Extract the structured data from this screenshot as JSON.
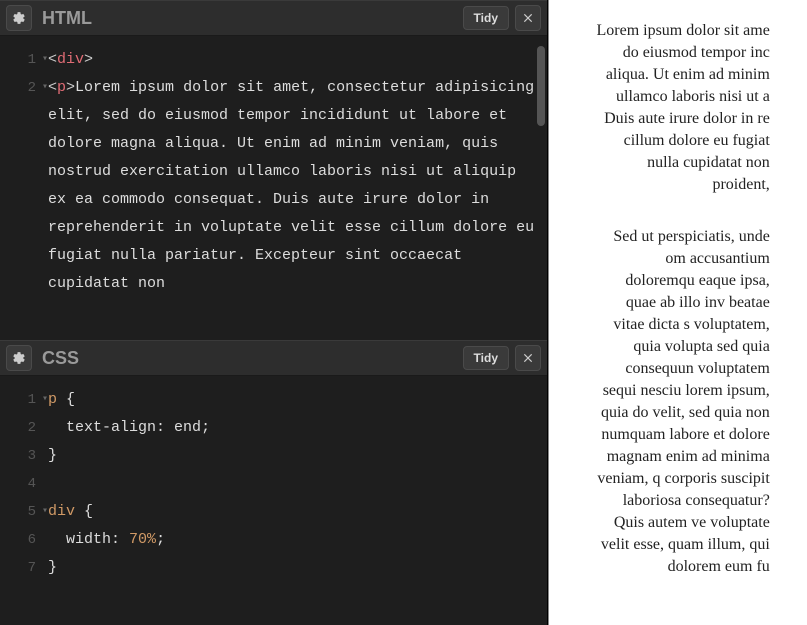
{
  "panels": {
    "html": {
      "title": "HTML",
      "tidy_label": "Tidy",
      "lines": [
        "1",
        "2"
      ],
      "code_display": "<div>\n<p>Lorem ipsum dolor sit amet, consectetur adipisicing elit, sed do eiusmod tempor incididunt ut labore et dolore magna aliqua. Ut enim ad minim veniam, quis nostrud exercitation ullamco laboris nisi ut aliquip ex ea commodo consequat. Duis aute irure dolor in reprehenderit in voluptate velit esse cillum dolore eu fugiat nulla pariatur. Excepteur sint occaecat cupidatat non"
    },
    "css": {
      "title": "CSS",
      "tidy_label": "Tidy",
      "lines": [
        "1",
        "2",
        "3",
        "4",
        "5",
        "6",
        "7"
      ],
      "code_text": "p {\n  text-align: end;\n}\n\ndiv {\n  width: 70%;\n}"
    }
  },
  "preview": {
    "p1": "Lorem ipsum dolor sit ame do eiusmod tempor inc aliqua. Ut enim ad minim ullamco laboris nisi ut a Duis aute irure dolor in re cillum dolore eu fugiat nulla cupidatat non proident,",
    "p2": "Sed ut perspiciatis, unde om accusantium doloremqu eaque ipsa, quae ab illo inv beatae vitae dicta s voluptatem, quia volupta sed quia consequun voluptatem sequi nesciu lorem ipsum, quia do velit, sed quia non numquam labore et dolore magnam enim ad minima veniam, q corporis suscipit laboriosa consequatur? Quis autem ve voluptate velit esse, quam illum, qui dolorem eum fu"
  }
}
